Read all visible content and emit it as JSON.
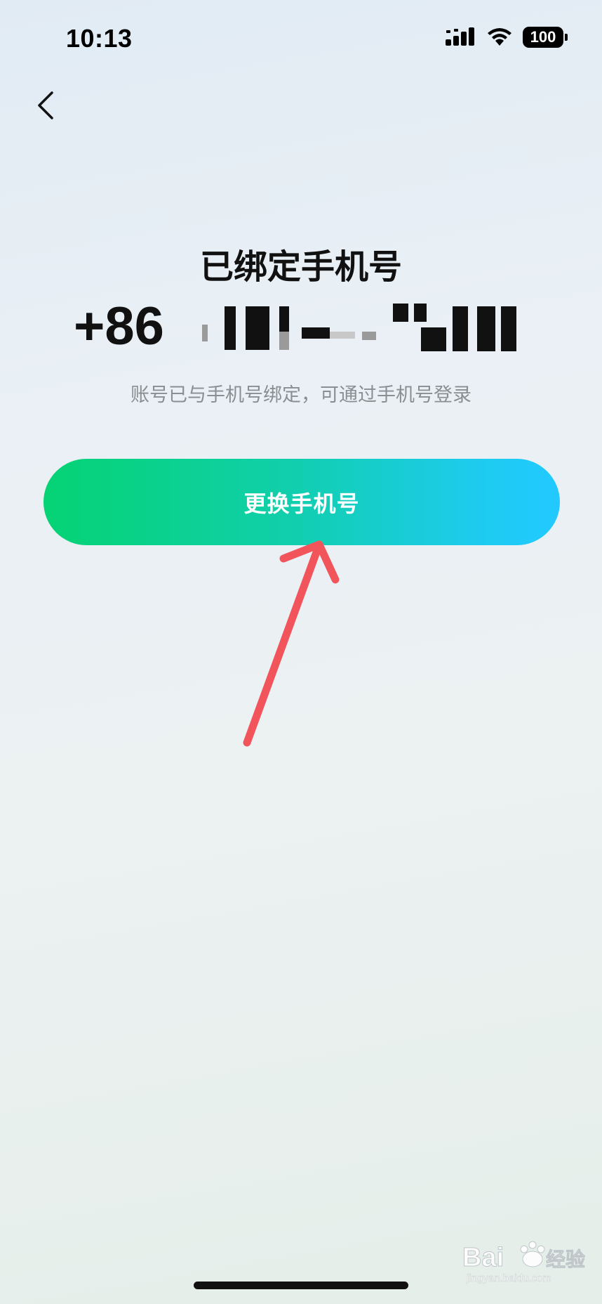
{
  "status_bar": {
    "time": "10:13",
    "battery": "100",
    "icons": [
      "signal-icon",
      "wifi-icon",
      "battery-icon"
    ]
  },
  "nav": {
    "back_icon": "chevron-left-icon"
  },
  "main": {
    "title": "已绑定手机号",
    "phone_prefix": "+86",
    "phone_visible_tail": "478",
    "subtitle": "账号已与手机号绑定，可通过手机号登录",
    "change_button_label": "更换手机号"
  },
  "colors": {
    "button_gradient_start": "#05d374",
    "button_gradient_end": "#22c9ff",
    "annotation_arrow": "#f2545b",
    "subtitle": "#8a8e93"
  },
  "watermark": {
    "brand": "Bai 经验",
    "url": "jingyan.baidu.com"
  }
}
